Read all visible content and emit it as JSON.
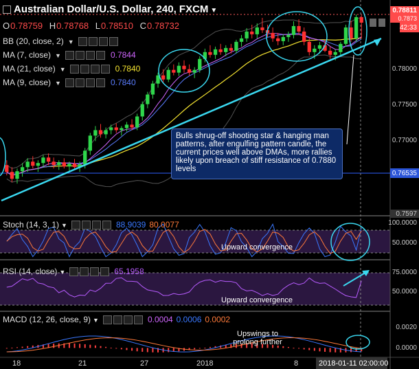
{
  "header": {
    "title": "Australian Dollar/U.S. Dollar, 240, FXCM",
    "ohlc": [
      {
        "k": "O",
        "v": "0.78759"
      },
      {
        "k": "H",
        "v": "0.78768"
      },
      {
        "k": "L",
        "v": "0.78510"
      },
      {
        "k": "C",
        "v": "0.78732"
      }
    ]
  },
  "indicators": [
    {
      "label": "BB (20, close, 2)",
      "value": "",
      "color": "#aaaaaa"
    },
    {
      "label": "MA (7, close)",
      "value": "0.7844",
      "color": "#d066ff"
    },
    {
      "label": "MA (21, close)",
      "value": "0.7840",
      "color": "#f6e531"
    },
    {
      "label": "MA (9, close)",
      "value": "0.7840",
      "color": "#5a7dff"
    }
  ],
  "price_axis": {
    "ticks": [
      "0.78000",
      "0.77500",
      "0.77000"
    ],
    "last_price": "0.78811",
    "tag_2": "0.7873",
    "countdown": "42:33",
    "support": "0.76535",
    "bottom": "0.7597"
  },
  "callout": "Bulls shrug-off shooting star & hanging man patterns, after engulfing pattern candle, the current prices well above DMAs, more rallies likely upon breach of stiff resistance of 0.7880 levels",
  "stoch": {
    "label": "Stoch (14, 3, 1)",
    "v1": "88.9039",
    "v2": "80.0077",
    "ticks": [
      "100.0000",
      "50.0000"
    ],
    "annotation": "Upward convergence"
  },
  "rsi": {
    "label": "RSI (14, close)",
    "v1": "65.1958",
    "ticks": [
      "75.0000",
      "50.0000"
    ],
    "annotation": "Upward convergence"
  },
  "macd": {
    "label": "MACD (12, 26, close, 9)",
    "v1": "0.0004",
    "v2": "0.0006",
    "v3": "0.0002",
    "ticks": [
      "0.0020",
      "0.0000"
    ],
    "annotation": "Upswings to prolong further"
  },
  "time_axis": {
    "ticks": [
      "18",
      "21",
      "27",
      "2018",
      "8"
    ],
    "cursor_label": "2018-01-11 02:00:00"
  },
  "chart_data": {
    "type": "candlestick",
    "title": "Australian Dollar/U.S. Dollar, 240, FXCM",
    "ylim": [
      0.7597,
      0.7885
    ],
    "support_level": 0.76535,
    "candles": [
      [
        0.7665,
        0.7672,
        0.765,
        0.7655
      ],
      [
        0.7655,
        0.7662,
        0.764,
        0.7645
      ],
      [
        0.7645,
        0.766,
        0.7638,
        0.7656
      ],
      [
        0.7656,
        0.7668,
        0.7648,
        0.7662
      ],
      [
        0.7662,
        0.7675,
        0.7655,
        0.767
      ],
      [
        0.767,
        0.7678,
        0.766,
        0.7664
      ],
      [
        0.7664,
        0.7672,
        0.7655,
        0.7668
      ],
      [
        0.7668,
        0.768,
        0.7662,
        0.7676
      ],
      [
        0.7676,
        0.7682,
        0.7665,
        0.767
      ],
      [
        0.767,
        0.7676,
        0.766,
        0.7665
      ],
      [
        0.7665,
        0.7672,
        0.7658,
        0.7669
      ],
      [
        0.7669,
        0.7675,
        0.766,
        0.7663
      ],
      [
        0.7663,
        0.767,
        0.7655,
        0.7667
      ],
      [
        0.7667,
        0.7674,
        0.766,
        0.7662
      ],
      [
        0.7662,
        0.767,
        0.7655,
        0.7666
      ],
      [
        0.7666,
        0.769,
        0.766,
        0.7686
      ],
      [
        0.7686,
        0.7712,
        0.768,
        0.7708
      ],
      [
        0.7708,
        0.7722,
        0.77,
        0.7716
      ],
      [
        0.7716,
        0.7725,
        0.7705,
        0.771
      ],
      [
        0.771,
        0.772,
        0.7704,
        0.7716
      ],
      [
        0.7716,
        0.7724,
        0.771,
        0.772
      ],
      [
        0.772,
        0.7726,
        0.7712,
        0.7716
      ],
      [
        0.7716,
        0.7722,
        0.7708,
        0.7719
      ],
      [
        0.7719,
        0.7728,
        0.7714,
        0.7724
      ],
      [
        0.7724,
        0.7732,
        0.7716,
        0.772
      ],
      [
        0.772,
        0.774,
        0.7716,
        0.7736
      ],
      [
        0.7736,
        0.7758,
        0.773,
        0.7754
      ],
      [
        0.7754,
        0.7772,
        0.7748,
        0.7768
      ],
      [
        0.7768,
        0.7788,
        0.7762,
        0.7784
      ],
      [
        0.7784,
        0.78,
        0.7778,
        0.7796
      ],
      [
        0.7796,
        0.7805,
        0.7785,
        0.779
      ],
      [
        0.779,
        0.7808,
        0.7786,
        0.7804
      ],
      [
        0.7804,
        0.7812,
        0.7796,
        0.78
      ],
      [
        0.78,
        0.7815,
        0.7795,
        0.781
      ],
      [
        0.781,
        0.7818,
        0.78,
        0.7805
      ],
      [
        0.7805,
        0.7812,
        0.7796,
        0.78
      ],
      [
        0.78,
        0.7808,
        0.7792,
        0.7804
      ],
      [
        0.7804,
        0.7824,
        0.78,
        0.782
      ],
      [
        0.782,
        0.7835,
        0.7815,
        0.783
      ],
      [
        0.783,
        0.784,
        0.7822,
        0.7826
      ],
      [
        0.7826,
        0.7838,
        0.782,
        0.7834
      ],
      [
        0.7834,
        0.7842,
        0.7826,
        0.783
      ],
      [
        0.783,
        0.784,
        0.7824,
        0.7836
      ],
      [
        0.7836,
        0.7842,
        0.7828,
        0.7832
      ],
      [
        0.7832,
        0.7848,
        0.7828,
        0.7845
      ],
      [
        0.7845,
        0.7855,
        0.7838,
        0.785
      ],
      [
        0.785,
        0.7865,
        0.7845,
        0.786
      ],
      [
        0.786,
        0.787,
        0.785,
        0.7856
      ],
      [
        0.7856,
        0.7872,
        0.785,
        0.7866
      ],
      [
        0.7866,
        0.788,
        0.7858,
        0.7862
      ],
      [
        0.7862,
        0.787,
        0.7852,
        0.7858
      ],
      [
        0.7858,
        0.7866,
        0.7845,
        0.785
      ],
      [
        0.785,
        0.7858,
        0.784,
        0.7846
      ],
      [
        0.7846,
        0.7856,
        0.784,
        0.7852
      ],
      [
        0.7852,
        0.786,
        0.7845,
        0.7855
      ],
      [
        0.7855,
        0.7875,
        0.785,
        0.7868
      ],
      [
        0.7868,
        0.7878,
        0.7855,
        0.786
      ],
      [
        0.786,
        0.7866,
        0.784,
        0.7845
      ],
      [
        0.7845,
        0.785,
        0.7825,
        0.783
      ],
      [
        0.783,
        0.784,
        0.782,
        0.7835
      ],
      [
        0.7835,
        0.7845,
        0.7828,
        0.784
      ],
      [
        0.784,
        0.7848,
        0.783,
        0.7832
      ],
      [
        0.7832,
        0.7838,
        0.782,
        0.7826
      ],
      [
        0.7826,
        0.7834,
        0.7818,
        0.783
      ],
      [
        0.783,
        0.7845,
        0.7825,
        0.7842
      ],
      [
        0.7842,
        0.787,
        0.7838,
        0.7866
      ],
      [
        0.7866,
        0.7876,
        0.7845,
        0.785
      ],
      [
        0.785,
        0.7885,
        0.7845,
        0.7881
      ],
      [
        0.7881,
        0.7884,
        0.785,
        0.7873
      ]
    ]
  }
}
